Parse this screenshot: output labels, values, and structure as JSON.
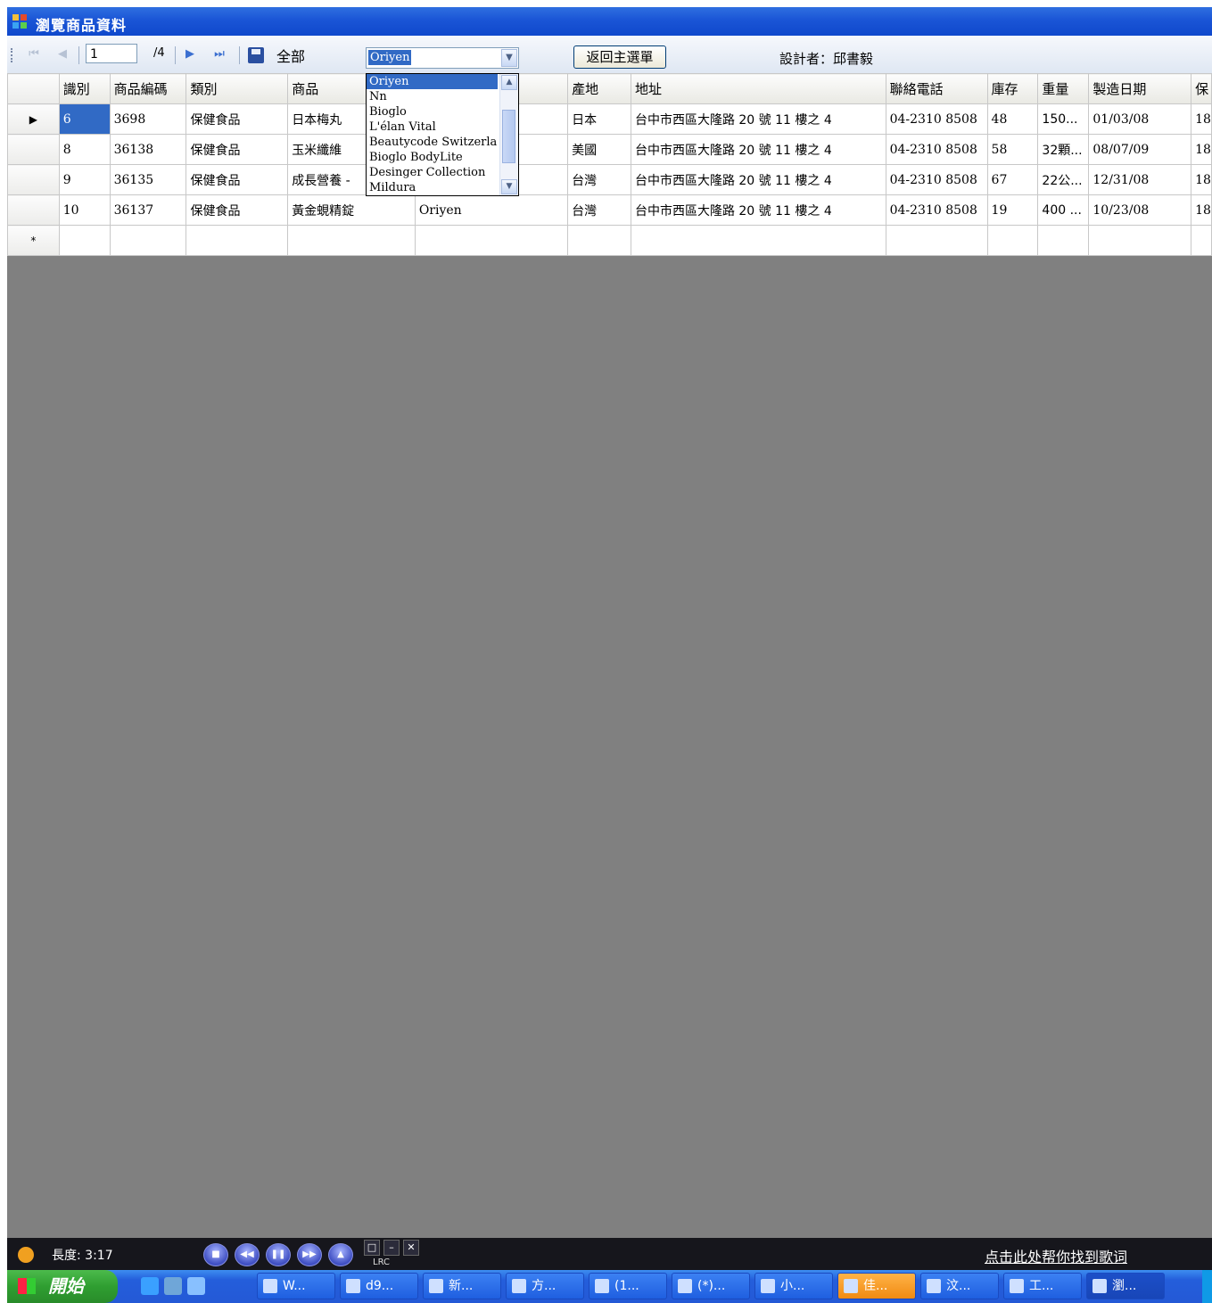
{
  "window": {
    "title": "瀏覽商品資料"
  },
  "toolbar": {
    "position": "1",
    "count": "/4",
    "all_label": "全部",
    "filter_value": "Oriyen",
    "back_button": "返回主選單",
    "designer": "設計者：邱書毅"
  },
  "dropdown": {
    "options": [
      "Oriyen",
      "Nn",
      "Bioglo",
      "L'élan Vital",
      "Beautycode Switzerla",
      "Bioglo BodyLite",
      "Desinger Collection",
      "Mildura"
    ],
    "selected": "Oriyen"
  },
  "grid": {
    "headers": [
      "識別",
      "商品編碼",
      "類別",
      "商品",
      "",
      "產地",
      "地址",
      "聯絡電話",
      "庫存",
      "重量",
      "製造日期",
      "保"
    ],
    "rows": [
      [
        "6",
        "3698",
        "保健食品",
        "日本梅丸",
        "",
        "日本",
        "台中市西區大隆路 20 號 11 樓之 4",
        "04-2310 8508",
        "48",
        "150...",
        "01/03/08",
        "18"
      ],
      [
        "8",
        "36138",
        "保健食品",
        "玉米纖維",
        "",
        "美國",
        "台中市西區大隆路 20 號 11 樓之 4",
        "04-2310 8508",
        "58",
        "32顆...",
        "08/07/09",
        "18"
      ],
      [
        "9",
        "36135",
        "保健食品",
        "成長營養 -",
        "",
        "台灣",
        "台中市西區大隆路 20 號 11 樓之 4",
        "04-2310 8508",
        "67",
        "22公...",
        "12/31/08",
        "18"
      ],
      [
        "10",
        "36137",
        "保健食品",
        "黃金蜆精錠",
        "Oriyen",
        "台灣",
        "台中市西區大隆路 20 號 11 樓之 4",
        "04-2310 8508",
        "19",
        "400 ...",
        "10/23/08",
        "18"
      ]
    ],
    "new_row_marker": "*",
    "current_row_marker": "▶"
  },
  "player": {
    "length": "長度: 3:17",
    "lrc": "LRC",
    "lyric_link": "点击此处帮你找到歌词"
  },
  "taskbar": {
    "start": "開始",
    "tasks": [
      "W...",
      "d9...",
      "新...",
      "方...",
      "(1...",
      "(*)...",
      "小...",
      "佳...",
      "汶...",
      "工...",
      "瀏..."
    ]
  },
  "colors": {
    "title_bar": "#1a55d6",
    "selection": "#316ac5",
    "grid_bg": "#808080",
    "taskbar": "#245edb",
    "start": "#2f9e31"
  }
}
